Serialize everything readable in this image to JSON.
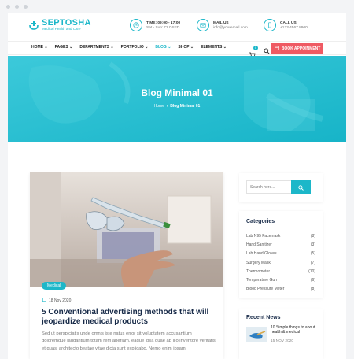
{
  "brand": {
    "name": "SEPTOSHA",
    "tagline": "Medical Health and Care",
    "accent": "#1cb7c9",
    "cta_color": "#ef5a63"
  },
  "contact": {
    "time_label": "TIME: 09:00 - 17:00",
    "time_value": "Sat - Sun: CLOSED",
    "mail_label": "MAIL US",
    "mail_value": "info@youremail.com",
    "call_label": "CALL US",
    "call_value": "+123 4567 8900"
  },
  "nav": {
    "items": [
      {
        "label": "HOME",
        "icon": "chevron-down-icon"
      },
      {
        "label": "PAGES",
        "icon": "chevron-down-icon"
      },
      {
        "label": "DEPARTMENTS",
        "icon": "chevron-down-icon"
      },
      {
        "label": "PORTFOLIO",
        "icon": "chevron-down-icon"
      },
      {
        "label": "BLOG",
        "icon": "chevron-down-icon"
      },
      {
        "label": "SHOP",
        "icon": "chevron-down-icon"
      },
      {
        "label": "ELEMENTS",
        "icon": "chevron-down-icon"
      }
    ],
    "cart_count": "0",
    "book_label": "BOOK APPOINMENT"
  },
  "hero": {
    "title": "Blog Minimal 01",
    "crumb_home": "Home",
    "crumb_separator": "›",
    "crumb_current": "Blog Minimal 01"
  },
  "post": {
    "tag": "Medical",
    "date": "18 Nov 2020",
    "title": "5 Conventional advertising methods that will jeopardize medical products",
    "excerpt": "Sed ut perspiciatis unde omnis iste natus error sit voluptatem accusantium doloremque laudantium totam rem aperiam, eaque ipsa quae ab illo inventore veritatis et quasi architecto beatae vitae dicta sunt explicabo. Nemo enim ipsam"
  },
  "sidebar": {
    "search_placeholder": "Search here...",
    "categories_title": "Categories",
    "categories": [
      {
        "name": "Lab N95 Facemask",
        "count": "(8)"
      },
      {
        "name": "Hand Sanitizer",
        "count": "(3)"
      },
      {
        "name": "Lab Hand Gloves",
        "count": "(5)"
      },
      {
        "name": "Surgery Mask",
        "count": "(7)"
      },
      {
        "name": "Thermometer",
        "count": "(10)"
      },
      {
        "name": "Temperature Gun",
        "count": "(6)"
      },
      {
        "name": "Blood Pressure Meter",
        "count": "(8)"
      }
    ],
    "news_title": "Recent News",
    "news_item": {
      "title": "10 Simple things to about health & medical",
      "date": "15 NOV 2020"
    }
  }
}
